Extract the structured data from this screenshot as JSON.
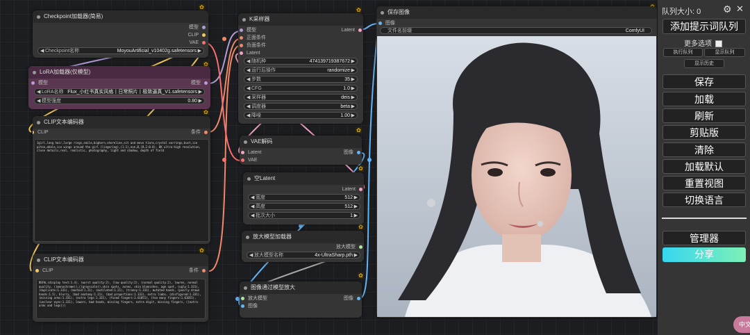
{
  "nodes": {
    "checkpoint": {
      "title": "Checkpoint加载器(简易)",
      "outputs": [
        "模型",
        "CLIP",
        "VAE"
      ],
      "widget_label": "Checkpoint名称",
      "widget_value": "MoyouArtificial_v10402g.safetensors"
    },
    "lora": {
      "title": "LoRA加载器(仅模型)",
      "input": "模型",
      "output": "模型",
      "lora_label": "LoRA名称",
      "lora_value": "Flux_小红书真实风格丨日常照片丨极致逼真_V1.safetensors",
      "strength_label": "模型强度",
      "strength_value": "0.80"
    },
    "clip_pos": {
      "title": "CLIP文本编码器",
      "input": "CLIP",
      "output": "条件",
      "text": "1girl,long hair,large rings,smile,bighorn,shoreline,sit and move tiara,crystal earrings,bust,ice piton,ahale,ice wings around the girl (lingering),(1.1),eve,B,(B,2:0.8), 8K ultra-high resolution, close details,real, realistic, photography, light and shadow, depth of field"
    },
    "clip_neg": {
      "title": "CLIP文本编码器",
      "input": "CLIP",
      "output": "条件",
      "text": "NSFW,(display text:1.4), (worst quality:2), (low quality:2), (normal quality:2), lowres, normal quality, ((monochrome)),((grayscale)),skin spots, acnes, skin blemishes, age spot, (ugly:1.331), (duplicate:1.331), (morbid:1.21), (mutilated:1.21), (tranny:1.331), mutated hands, (poorly drawn hands:1.5), blurry, (bad anatomy:1.21), (bad proportions:1.331), extra limbs, (disfigured:1.331), (missing arms:1.331), (extra legs:1.331), (fused fingers:1.61051), (too many fingers:1.61051), (unclear eyes:1.331), lowers, bad hands, missing fingers, extra digit, missing fingers, ((extra arms and legs)))"
    },
    "ksampler": {
      "title": "K采样器",
      "inputs": [
        "模型",
        "正面条件",
        "负面条件",
        "Latent"
      ],
      "output": "Latent",
      "widgets": [
        {
          "label": "随机种",
          "value": "474139719387672"
        },
        {
          "label": "运行后操作",
          "value": "randomize"
        },
        {
          "label": "步数",
          "value": "35"
        },
        {
          "label": "CFG",
          "value": "1.0"
        },
        {
          "label": "采样器",
          "value": "deis"
        },
        {
          "label": "调度器",
          "value": "beta"
        },
        {
          "label": "降噪",
          "value": "1.00"
        }
      ]
    },
    "vae": {
      "title": "VAE解码",
      "inputs": [
        "Latent",
        "VAE"
      ],
      "output": "图像"
    },
    "empty_latent": {
      "title": "空Latent",
      "output": "Latent",
      "widgets": [
        {
          "label": "宽度",
          "value": "512"
        },
        {
          "label": "高度",
          "value": "512"
        },
        {
          "label": "批次大小",
          "value": "1"
        }
      ]
    },
    "upscale_loader": {
      "title": "放大模型加载器",
      "output": "放大模型",
      "widget_label": "放大模型名称",
      "widget_value": "4x-UltraSharp.pth"
    },
    "upscale": {
      "title": "图像通过模型放大",
      "inputs": [
        "放大模型",
        "图像"
      ],
      "output": "图像"
    },
    "save": {
      "title": "保存图像",
      "input": "图像",
      "widget_label": "文件名前缀",
      "widget_value": "ComfyUI"
    }
  },
  "panel": {
    "queue_size": "队列大小: 0",
    "queue_prompt": "添加提示词队列",
    "extra_options": "更多选项",
    "view_queue": "执行队列",
    "view_queue2": "显示队列",
    "view_history": "显示历史",
    "save": "保存",
    "load": "加载",
    "refresh": "刷新",
    "clipspace": "剪贴版",
    "clear": "清除",
    "load_default": "加载默认",
    "reset_view": "重置视图",
    "switch_lang": "切换语言",
    "manager": "管理器",
    "share": "分享"
  },
  "translate_badge": "中文",
  "colors": {
    "lora_node": "#5a3650",
    "lora_title": "#4a2a43",
    "share_gradient_start": "#36d6f0",
    "share_gradient_end": "#7ef0b6",
    "link_clip": "#f5c85b",
    "link_cond": "#f08a68",
    "link_model": "#b39dd8",
    "link_latent": "#f4a3c6",
    "link_image": "#64b5f6",
    "link_vae": "#ff6e6e",
    "badge": "#f5b100"
  }
}
